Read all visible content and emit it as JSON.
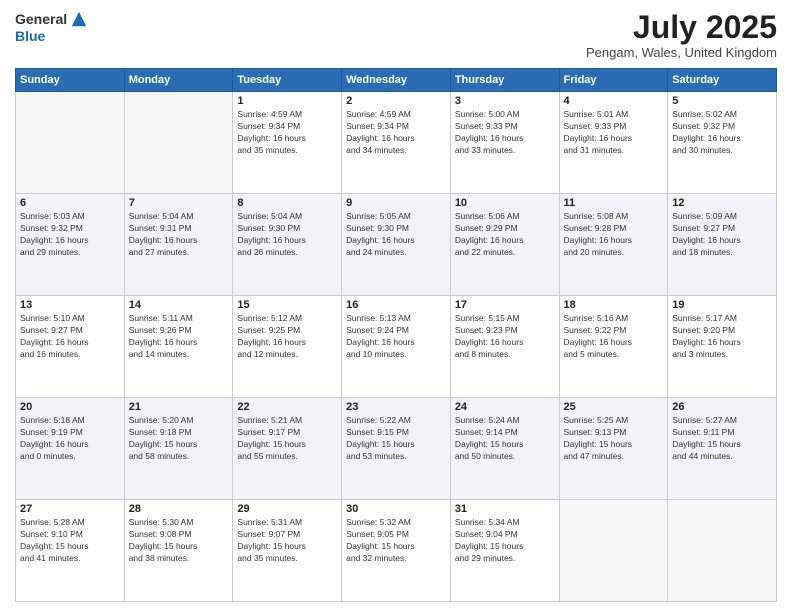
{
  "header": {
    "logo": {
      "general": "General",
      "blue": "Blue"
    },
    "title": "July 2025",
    "location": "Pengam, Wales, United Kingdom"
  },
  "days_of_week": [
    "Sunday",
    "Monday",
    "Tuesday",
    "Wednesday",
    "Thursday",
    "Friday",
    "Saturday"
  ],
  "weeks": [
    [
      {
        "day": "",
        "info": ""
      },
      {
        "day": "",
        "info": ""
      },
      {
        "day": "1",
        "info": "Sunrise: 4:59 AM\nSunset: 9:34 PM\nDaylight: 16 hours\nand 35 minutes."
      },
      {
        "day": "2",
        "info": "Sunrise: 4:59 AM\nSunset: 9:34 PM\nDaylight: 16 hours\nand 34 minutes."
      },
      {
        "day": "3",
        "info": "Sunrise: 5:00 AM\nSunset: 9:33 PM\nDaylight: 16 hours\nand 33 minutes."
      },
      {
        "day": "4",
        "info": "Sunrise: 5:01 AM\nSunset: 9:33 PM\nDaylight: 16 hours\nand 31 minutes."
      },
      {
        "day": "5",
        "info": "Sunrise: 5:02 AM\nSunset: 9:32 PM\nDaylight: 16 hours\nand 30 minutes."
      }
    ],
    [
      {
        "day": "6",
        "info": "Sunrise: 5:03 AM\nSunset: 9:32 PM\nDaylight: 16 hours\nand 29 minutes."
      },
      {
        "day": "7",
        "info": "Sunrise: 5:04 AM\nSunset: 9:31 PM\nDaylight: 16 hours\nand 27 minutes."
      },
      {
        "day": "8",
        "info": "Sunrise: 5:04 AM\nSunset: 9:30 PM\nDaylight: 16 hours\nand 26 minutes."
      },
      {
        "day": "9",
        "info": "Sunrise: 5:05 AM\nSunset: 9:30 PM\nDaylight: 16 hours\nand 24 minutes."
      },
      {
        "day": "10",
        "info": "Sunrise: 5:06 AM\nSunset: 9:29 PM\nDaylight: 16 hours\nand 22 minutes."
      },
      {
        "day": "11",
        "info": "Sunrise: 5:08 AM\nSunset: 9:28 PM\nDaylight: 16 hours\nand 20 minutes."
      },
      {
        "day": "12",
        "info": "Sunrise: 5:09 AM\nSunset: 9:27 PM\nDaylight: 16 hours\nand 18 minutes."
      }
    ],
    [
      {
        "day": "13",
        "info": "Sunrise: 5:10 AM\nSunset: 9:27 PM\nDaylight: 16 hours\nand 16 minutes."
      },
      {
        "day": "14",
        "info": "Sunrise: 5:11 AM\nSunset: 9:26 PM\nDaylight: 16 hours\nand 14 minutes."
      },
      {
        "day": "15",
        "info": "Sunrise: 5:12 AM\nSunset: 9:25 PM\nDaylight: 16 hours\nand 12 minutes."
      },
      {
        "day": "16",
        "info": "Sunrise: 5:13 AM\nSunset: 9:24 PM\nDaylight: 16 hours\nand 10 minutes."
      },
      {
        "day": "17",
        "info": "Sunrise: 5:15 AM\nSunset: 9:23 PM\nDaylight: 16 hours\nand 8 minutes."
      },
      {
        "day": "18",
        "info": "Sunrise: 5:16 AM\nSunset: 9:22 PM\nDaylight: 16 hours\nand 5 minutes."
      },
      {
        "day": "19",
        "info": "Sunrise: 5:17 AM\nSunset: 9:20 PM\nDaylight: 16 hours\nand 3 minutes."
      }
    ],
    [
      {
        "day": "20",
        "info": "Sunrise: 5:18 AM\nSunset: 9:19 PM\nDaylight: 16 hours\nand 0 minutes."
      },
      {
        "day": "21",
        "info": "Sunrise: 5:20 AM\nSunset: 9:18 PM\nDaylight: 15 hours\nand 58 minutes."
      },
      {
        "day": "22",
        "info": "Sunrise: 5:21 AM\nSunset: 9:17 PM\nDaylight: 15 hours\nand 55 minutes."
      },
      {
        "day": "23",
        "info": "Sunrise: 5:22 AM\nSunset: 9:15 PM\nDaylight: 15 hours\nand 53 minutes."
      },
      {
        "day": "24",
        "info": "Sunrise: 5:24 AM\nSunset: 9:14 PM\nDaylight: 15 hours\nand 50 minutes."
      },
      {
        "day": "25",
        "info": "Sunrise: 5:25 AM\nSunset: 9:13 PM\nDaylight: 15 hours\nand 47 minutes."
      },
      {
        "day": "26",
        "info": "Sunrise: 5:27 AM\nSunset: 9:11 PM\nDaylight: 15 hours\nand 44 minutes."
      }
    ],
    [
      {
        "day": "27",
        "info": "Sunrise: 5:28 AM\nSunset: 9:10 PM\nDaylight: 15 hours\nand 41 minutes."
      },
      {
        "day": "28",
        "info": "Sunrise: 5:30 AM\nSunset: 9:08 PM\nDaylight: 15 hours\nand 38 minutes."
      },
      {
        "day": "29",
        "info": "Sunrise: 5:31 AM\nSunset: 9:07 PM\nDaylight: 15 hours\nand 35 minutes."
      },
      {
        "day": "30",
        "info": "Sunrise: 5:32 AM\nSunset: 9:05 PM\nDaylight: 15 hours\nand 32 minutes."
      },
      {
        "day": "31",
        "info": "Sunrise: 5:34 AM\nSunset: 9:04 PM\nDaylight: 15 hours\nand 29 minutes."
      },
      {
        "day": "",
        "info": ""
      },
      {
        "day": "",
        "info": ""
      }
    ]
  ]
}
